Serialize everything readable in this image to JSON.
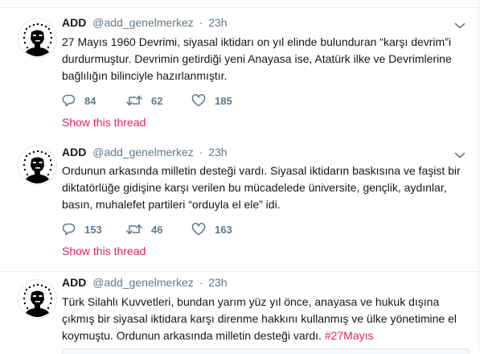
{
  "colors": {
    "accent": "#e0245e",
    "text": "#14171a",
    "secondary": "#657786",
    "divider": "#e6ecf0"
  },
  "icons": {
    "reply": "reply-icon",
    "retweet": "retweet-icon",
    "like": "heart-icon",
    "menu": "chevron-down-icon",
    "avatar": "avatar"
  },
  "tweets": [
    {
      "name": "ADD",
      "handle": "@add_genelmerkez",
      "separator": "·",
      "time": "23h",
      "text": "27 Mayıs 1960 Devrimi, siyasal iktidarı on yıl elinde bulunduran “karşı devrim”i durdurmuştur. Devrimin getirdiği yeni Anayasa ise, Atatürk ilke ve Devrimlerine bağlılığın bilinciyle hazırlanmıştır.",
      "replies": "84",
      "retweets": "62",
      "likes": "185",
      "thread_link": "Show this thread"
    },
    {
      "name": "ADD",
      "handle": "@add_genelmerkez",
      "separator": "·",
      "time": "23h",
      "text": "Ordunun arkasında milletin desteği vardı. Siyasal iktidarın baskısına ve faşist bir diktatörlüğe gidişine karşı verilen bu mücadelede üniversite, gençlik, aydınlar, basın, muhalefet partileri “orduyla el ele” idi.",
      "replies": "153",
      "retweets": "46",
      "likes": "163",
      "thread_link": "Show this thread"
    },
    {
      "name": "ADD",
      "handle": "@add_genelmerkez",
      "separator": "·",
      "time": "23h",
      "text": "Türk Silahlı Kuvvetleri, bundan yarım yüz yıl önce, anayasa ve hukuk dışına çıkmış bir siyasal iktidara karşı direnme hakkını kullanmış ve ülke yönetimine el koymuştu. Ordunun arkasında milletin desteği vardı.",
      "hashtag": "#27Mayıs"
    }
  ]
}
